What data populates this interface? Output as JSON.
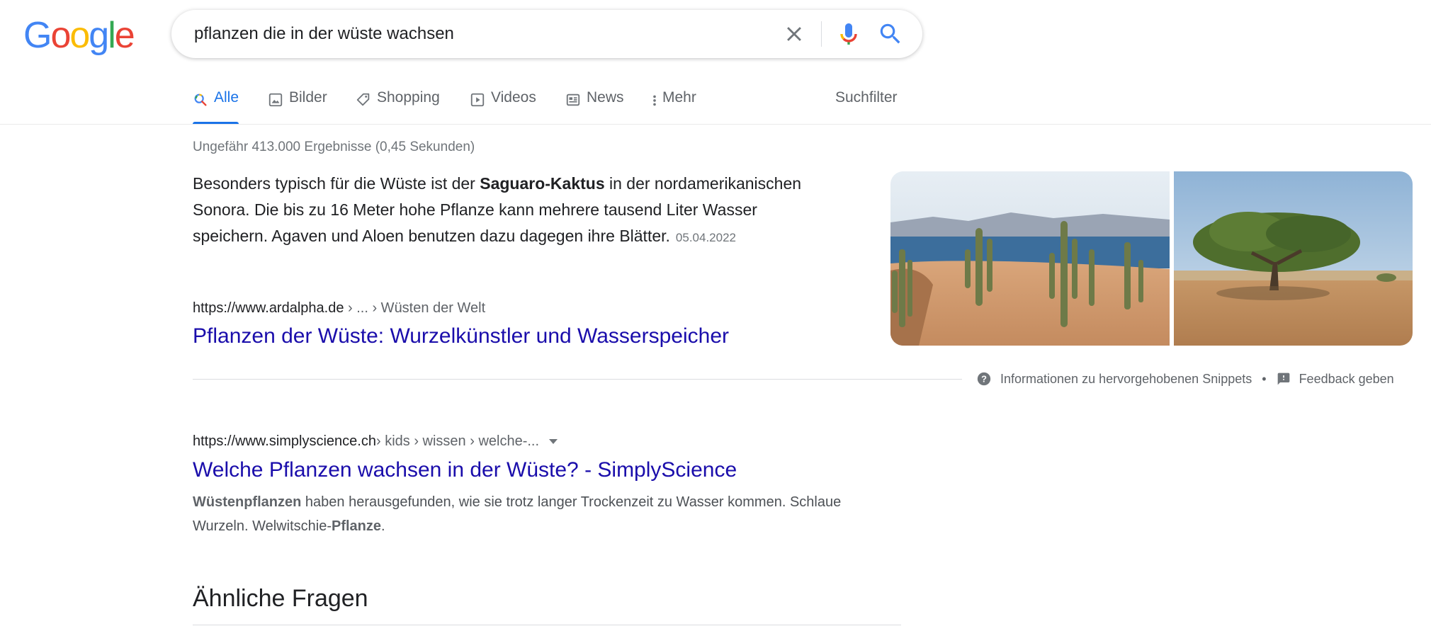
{
  "logo": {
    "text": "Google",
    "letters": [
      "G",
      "o",
      "o",
      "g",
      "l",
      "e"
    ],
    "colors": [
      "#4285F4",
      "#EA4335",
      "#FBBC05",
      "#4285F4",
      "#34A853",
      "#EA4335"
    ]
  },
  "search": {
    "query": "pflanzen die in der wüste wachsen"
  },
  "tabs": [
    {
      "label": "Alle",
      "icon": "search-icon",
      "active": true
    },
    {
      "label": "Bilder",
      "icon": "image-icon"
    },
    {
      "label": "Shopping",
      "icon": "tag-icon"
    },
    {
      "label": "Videos",
      "icon": "play-icon"
    },
    {
      "label": "News",
      "icon": "news-icon"
    },
    {
      "label": "Mehr",
      "icon": "more-vert-icon"
    }
  ],
  "suchfilter": "Suchfilter",
  "stats": "Ungefähr 413.000 Ergebnisse (0,45 Sekunden)",
  "featured": {
    "text_before": "Besonders typisch für die Wüste ist der ",
    "bold": "Saguaro-Kaktus",
    "text_after": " in der nordamerikanischen Sonora. Die bis zu 16 Meter hohe Pflanze kann mehrere tausend Liter Wasser speichern. Agaven und Aloen benutzen dazu dagegen ihre Blätter.",
    "date": "05.04.2022",
    "cite_domain": "https://www.ardalpha.de",
    "cite_path": " › ... › Wüsten der Welt",
    "title": "Pflanzen der Wüste: Wurzelkünstler und Wasserspeicher",
    "info": "Informationen zu hervorgehobenen Snippets",
    "dot": "•",
    "feedback": "Feedback geben"
  },
  "result2": {
    "cite_domain": "https://www.simplyscience.ch",
    "cite_path": " › kids › wissen › welche-...",
    "title": "Welche Pflanzen wachsen in der Wüste? - SimplyScience",
    "desc_bold1": "Wüstenpflanzen",
    "desc_mid": " haben herausgefunden, wie sie trotz langer Trockenzeit zu Wasser kommen. Schlaue Wurzeln. Welwitschie-",
    "desc_bold2": "Pflanze",
    "desc_end": "."
  },
  "paa": {
    "title": "Ähnliche Fragen"
  },
  "colors": {
    "link": "#1a0dab",
    "accent": "#1a73e8",
    "muted": "#5f6368"
  }
}
